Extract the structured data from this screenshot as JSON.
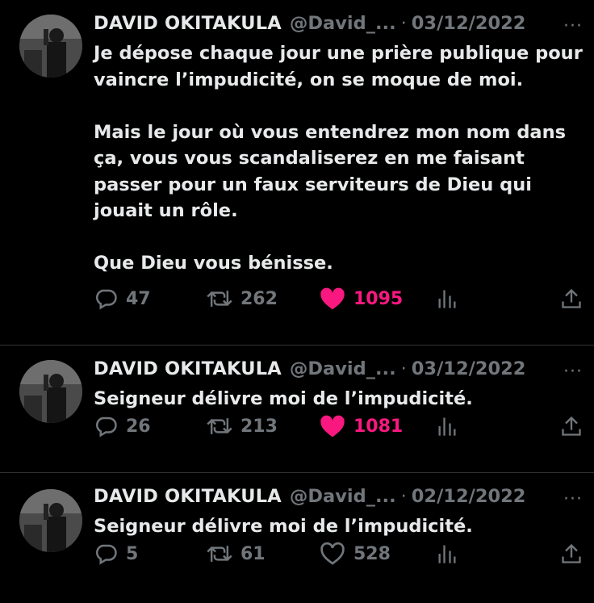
{
  "tweets": [
    {
      "name": "DAVID OKITAKULA",
      "handle": "@David_...",
      "date": "03/12/2022",
      "text": "Je dépose chaque jour une prière publique pour\nvaincre l’impudicité, on se moque de moi.\n\nMais le jour où vous entendrez mon nom dans\nça, vous vous scandaliserez en me faisant\npasser pour un faux serviteurs de Dieu qui\njouait un rôle.\n\nQue Dieu vous bénisse.",
      "replies": "47",
      "retweets": "262",
      "likes": "1095",
      "liked": true
    },
    {
      "name": "DAVID OKITAKULA",
      "handle": "@David_...",
      "date": "03/12/2022",
      "text": "Seigneur délivre moi de l’impudicité.",
      "replies": "26",
      "retweets": "213",
      "likes": "1081",
      "liked": true
    },
    {
      "name": "DAVID OKITAKULA",
      "handle": "@David_...",
      "date": "02/12/2022",
      "text": "Seigneur délivre moi de l’impudicité.",
      "replies": "5",
      "retweets": "61",
      "likes": "528",
      "liked": false
    }
  ],
  "separator": "·",
  "more_label": "···",
  "colors": {
    "like_active": "#f91880",
    "muted": "#71767b",
    "text": "#e7e9ea",
    "background": "#000000"
  },
  "icons": [
    "reply-icon",
    "retweet-icon",
    "heart-icon",
    "views-icon",
    "share-icon",
    "more-icon"
  ]
}
